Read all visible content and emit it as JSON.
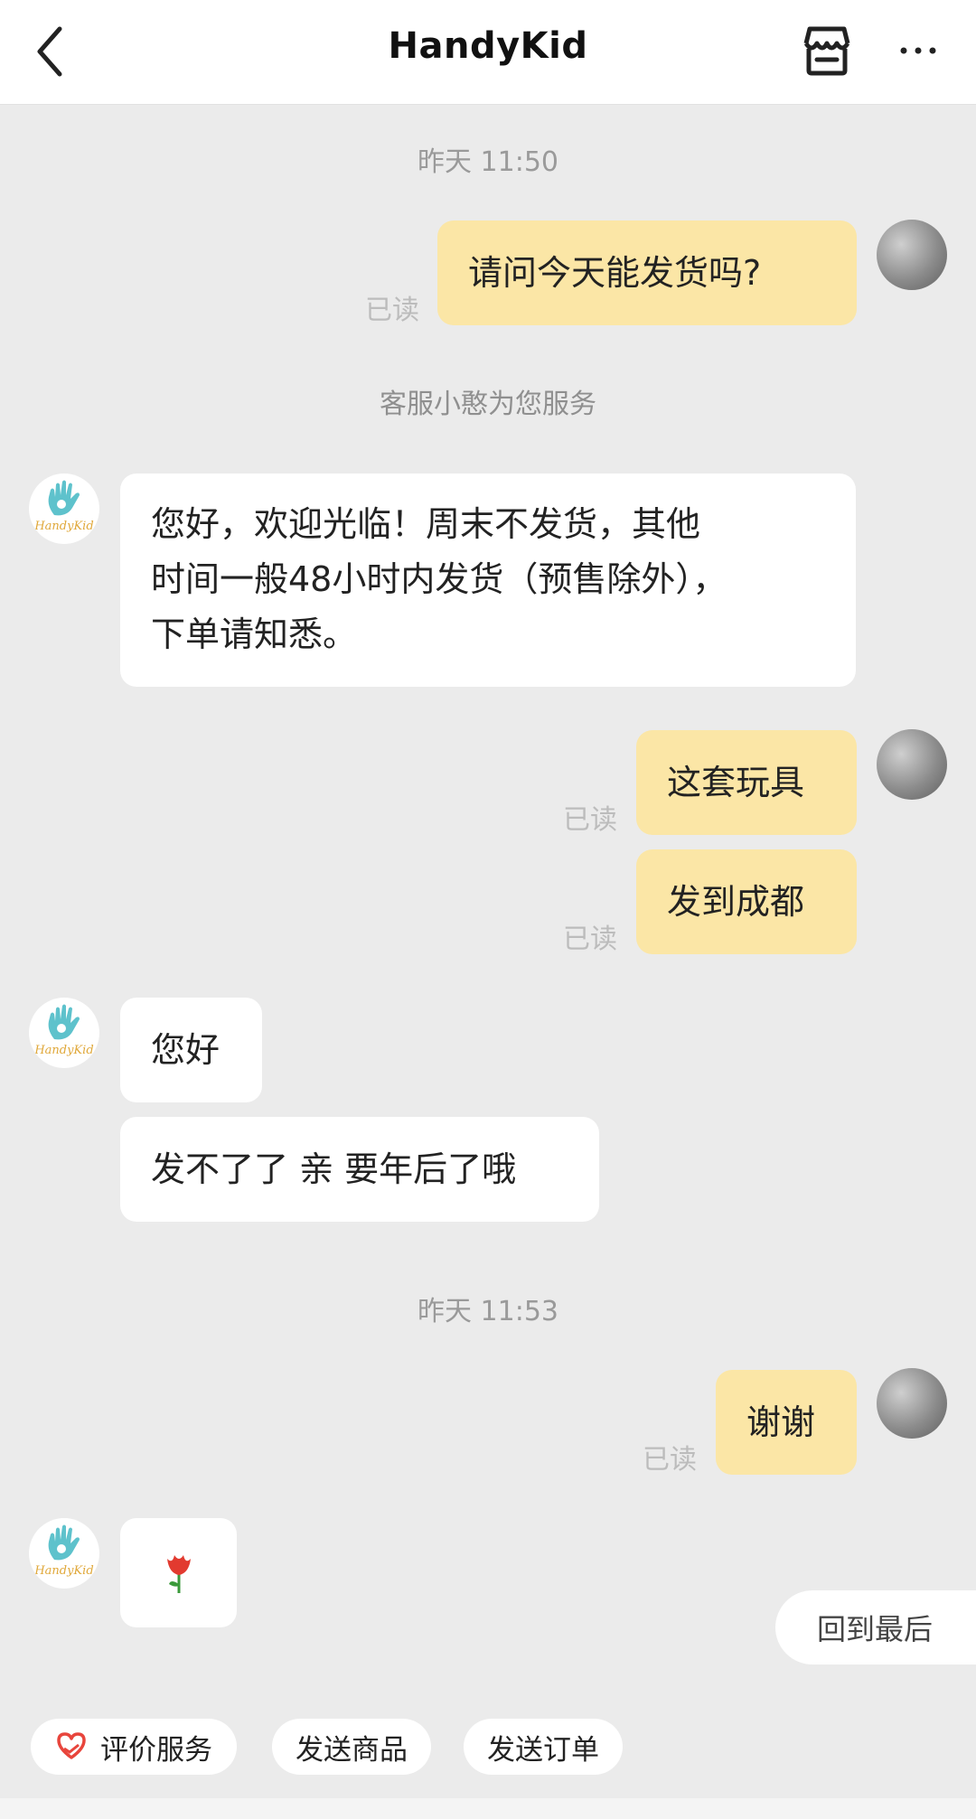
{
  "header": {
    "title": "HandyKid",
    "icons": {
      "back": "chevron-left-icon",
      "shop": "shop-icon",
      "more": "more-icon"
    }
  },
  "messages": {
    "ts1": "昨天 11:50",
    "m1": "请问今天能发货吗?",
    "read1": "已读",
    "note": "客服小憨为您服务",
    "m2_line1": "您好，欢迎光临！周末不发货，其他",
    "m2_line2": "时间一般48小时内发货（预售除外），",
    "m2_line3": "下单请知悉。",
    "m3": "这套玩具",
    "read3": "已读",
    "m4": "发到成都",
    "read4": "已读",
    "m5": "您好",
    "m6": "发不了了 亲 要年后了哦",
    "ts2": "昨天 11:53",
    "m7": "谢谢",
    "read7": "已读",
    "m8_emoji": "🌹"
  },
  "shop_avatar_label": "HandyKid",
  "jump_to_latest": "回到最后",
  "quick_actions": {
    "rate": "评价服务",
    "send_product": "发送商品",
    "send_order": "发送订单"
  },
  "colors": {
    "my_bubble": "#fbe6a6",
    "their_bubble": "#ffffff",
    "background": "#ebebeb",
    "read_text": "#bcbcbc"
  }
}
